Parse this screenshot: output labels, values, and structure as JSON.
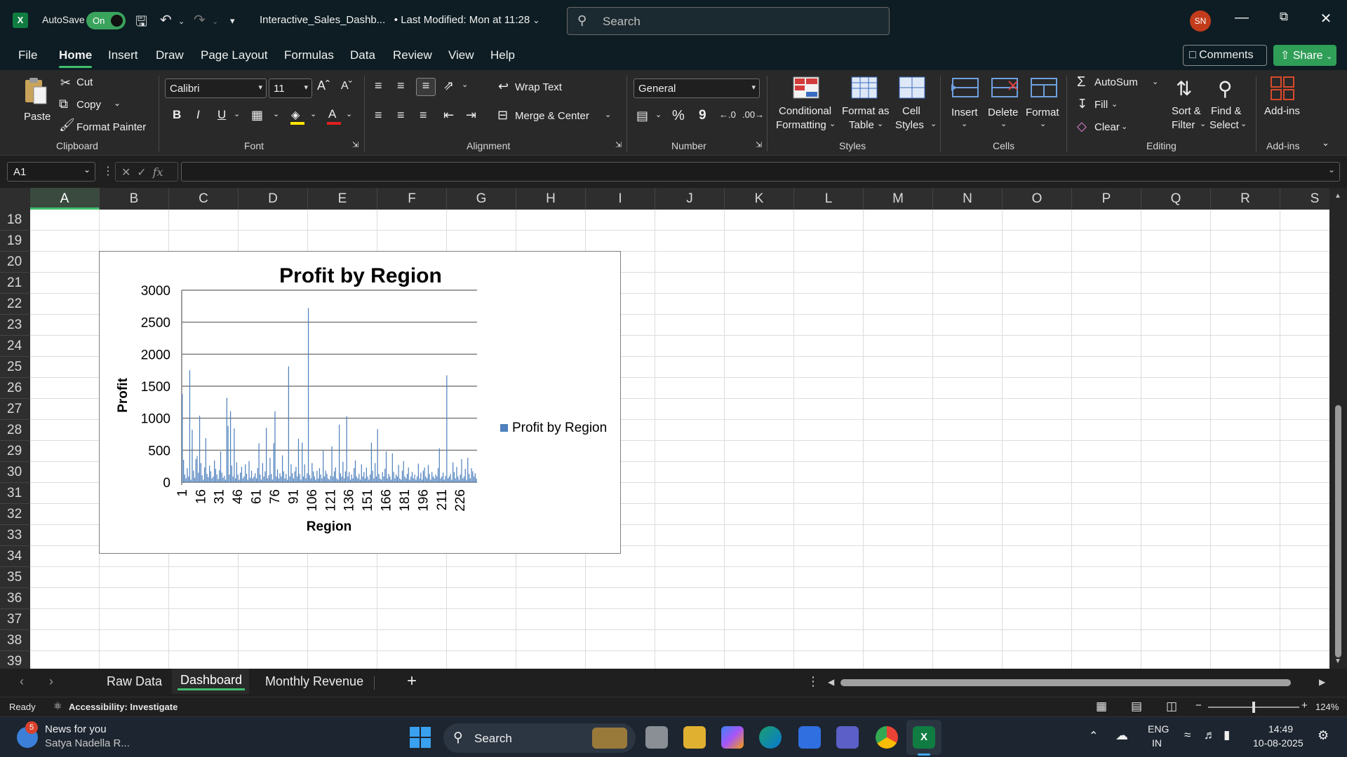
{
  "app": {
    "autosave_label": "AutoSave",
    "autosave_state": "On",
    "doc_title": "Interactive_Sales_Dashb...",
    "last_modified": "• Last Modified: Mon at 11:28",
    "search_placeholder": "Search",
    "avatar_initials": "SN",
    "comments_label": "Comments",
    "share_label": "Share"
  },
  "menu": {
    "tabs": [
      "File",
      "Home",
      "Insert",
      "Draw",
      "Page Layout",
      "Formulas",
      "Data",
      "Review",
      "View",
      "Help"
    ],
    "active": "Home"
  },
  "ribbon": {
    "clipboard": {
      "paste": "Paste",
      "cut": "Cut",
      "copy": "Copy",
      "format_painter": "Format Painter",
      "label": "Clipboard"
    },
    "font": {
      "name": "Calibri",
      "size": "11",
      "label": "Font",
      "bold": "B",
      "italic": "I",
      "underline": "U"
    },
    "alignment": {
      "wrap_text": "Wrap Text",
      "merge_center": "Merge & Center",
      "label": "Alignment"
    },
    "number": {
      "format": "General",
      "label": "Number",
      "percent": "%",
      "comma": "9"
    },
    "styles": {
      "conditional_1": "Conditional",
      "conditional_2": "Formatting",
      "format_table_1": "Format as",
      "format_table_2": "Table",
      "cell_styles_1": "Cell",
      "cell_styles_2": "Styles",
      "label": "Styles"
    },
    "cells": {
      "insert": "Insert",
      "delete": "Delete",
      "format": "Format",
      "label": "Cells"
    },
    "editing": {
      "autosum": "AutoSum",
      "fill": "Fill",
      "clear": "Clear",
      "sort_1": "Sort &",
      "sort_2": "Filter",
      "find_1": "Find &",
      "find_2": "Select",
      "label": "Editing"
    },
    "addins": {
      "addins": "Add-ins",
      "label": "Add-ins"
    }
  },
  "formula_bar": {
    "name_box": "A1",
    "fx": "fx",
    "value": ""
  },
  "grid": {
    "columns": [
      "A",
      "B",
      "C",
      "D",
      "E",
      "F",
      "G",
      "H",
      "I",
      "J",
      "K",
      "L",
      "M",
      "N",
      "O",
      "P",
      "Q",
      "R",
      "S"
    ],
    "selected_column": "A",
    "rows": [
      "18",
      "19",
      "20",
      "21",
      "22",
      "23",
      "24",
      "25",
      "26",
      "27",
      "28",
      "29",
      "30",
      "31",
      "32",
      "33",
      "34",
      "35",
      "36",
      "37",
      "38",
      "39"
    ]
  },
  "chart_data": {
    "type": "bar",
    "title": "Profit by Region",
    "xlabel": "Region",
    "ylabel": "Profit",
    "ylim": [
      0,
      3000
    ],
    "yticks": [
      0,
      500,
      1000,
      1500,
      2000,
      2500,
      3000
    ],
    "xticks": [
      "1",
      "16",
      "31",
      "46",
      "61",
      "76",
      "91",
      "106",
      "121",
      "136",
      "151",
      "166",
      "181",
      "196",
      "211",
      "226"
    ],
    "legend": "right",
    "grid": true,
    "series": [
      {
        "name": "Profit by Region",
        "color": "#4f81bd",
        "x_start": 1,
        "values": [
          1380,
          350,
          120,
          60,
          220,
          90,
          1750,
          40,
          820,
          180,
          70,
          360,
          410,
          150,
          1040,
          300,
          110,
          40,
          230,
          690,
          130,
          80,
          260,
          170,
          60,
          90,
          340,
          210,
          120,
          50,
          190,
          480,
          150,
          70,
          100,
          40,
          1320,
          880,
          120,
          1110,
          260,
          90,
          840,
          60,
          310,
          120,
          40,
          150,
          240,
          60,
          90,
          280,
          130,
          40,
          330,
          70,
          180,
          60,
          90,
          140,
          60,
          220,
          610,
          120,
          40,
          300,
          90,
          170,
          850,
          60,
          110,
          380,
          130,
          40,
          610,
          1110,
          90,
          200,
          60,
          140,
          90,
          420,
          170,
          60,
          130,
          40,
          1810,
          90,
          280,
          140,
          60,
          170,
          240,
          90,
          680,
          130,
          40,
          620,
          90,
          280,
          60,
          140,
          2720,
          110,
          60,
          300,
          170,
          90,
          40,
          180,
          60,
          220,
          120,
          60,
          490,
          90,
          180,
          130,
          60,
          40,
          100,
          560,
          90,
          170,
          230,
          60,
          40,
          900,
          140,
          90,
          320,
          60,
          170,
          1030,
          90,
          160,
          40,
          120,
          60,
          220,
          340,
          90,
          60,
          130,
          40,
          280,
          90,
          160,
          60,
          230,
          90,
          40,
          120,
          620,
          180,
          60,
          300,
          90,
          830,
          130,
          60,
          40,
          160,
          90,
          210,
          480,
          60,
          130,
          90,
          40,
          450,
          160,
          60,
          120,
          90,
          270,
          60,
          40,
          180,
          330,
          90,
          60,
          130,
          230,
          40,
          90,
          160,
          60,
          120,
          40,
          90,
          290,
          60,
          150,
          40,
          180,
          230,
          90,
          60,
          270,
          130,
          40,
          160,
          90,
          60,
          120,
          90,
          220,
          530,
          60,
          90,
          150,
          40,
          100,
          1670,
          60,
          90,
          130,
          40,
          310,
          160,
          60,
          240,
          90,
          40,
          120,
          360,
          60,
          90,
          210,
          40,
          380,
          130,
          60,
          220,
          170,
          90,
          140,
          60
        ]
      }
    ]
  },
  "sheets": {
    "tabs": [
      "Raw Data",
      "Dashboard",
      "Monthly Revenue"
    ],
    "active": "Dashboard",
    "add": "+"
  },
  "status": {
    "ready": "Ready",
    "accessibility": "Accessibility: Investigate",
    "zoom": "124%"
  },
  "taskbar": {
    "news_title": "News for you",
    "news_sub": "Satya Nadella R...",
    "news_badge": "5",
    "search": "Search",
    "lang_1": "ENG",
    "lang_2": "IN",
    "time": "14:49",
    "date": "10-08-2025"
  }
}
